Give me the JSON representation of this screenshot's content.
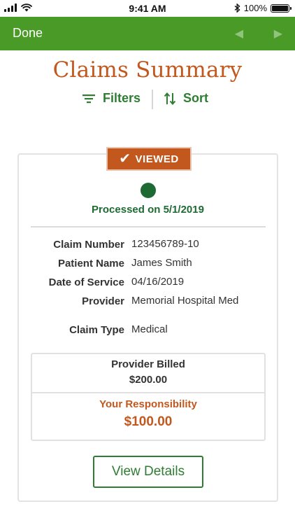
{
  "status_bar": {
    "time": "9:41 AM",
    "battery_text": "100%",
    "battery_level": 1.0,
    "icons": [
      "signal-icon",
      "wifi-icon",
      "bluetooth-icon",
      "battery-icon"
    ]
  },
  "nav": {
    "done_label": "Done",
    "prev_symbol": "◀",
    "next_symbol": "▶",
    "bar_color": "#4a9a28"
  },
  "page": {
    "title": "Claims Summary",
    "filters_label": "Filters",
    "sort_label": "Sort",
    "accent_color": "#c2581e",
    "green_color": "#2e7d32"
  },
  "claim": {
    "badge": "VIEWED",
    "badge_icon": "checkmark-icon",
    "processed_text": "Processed on 5/1/2019",
    "details": [
      {
        "label": "Claim Number",
        "value": "123456789-10"
      },
      {
        "label": "Patient Name",
        "value": "James Smith"
      },
      {
        "label": "Date of Service",
        "value": "04/16/2019"
      },
      {
        "label": "Provider",
        "value": "Memorial Hospital Med"
      },
      {
        "label": "Claim Type",
        "value": "Medical"
      }
    ],
    "provider_billed_label": "Provider Billed",
    "provider_billed_value": "$200.00",
    "responsibility_label": "Your Responsibility",
    "responsibility_value": "$100.00",
    "view_details_label": "View Details"
  }
}
